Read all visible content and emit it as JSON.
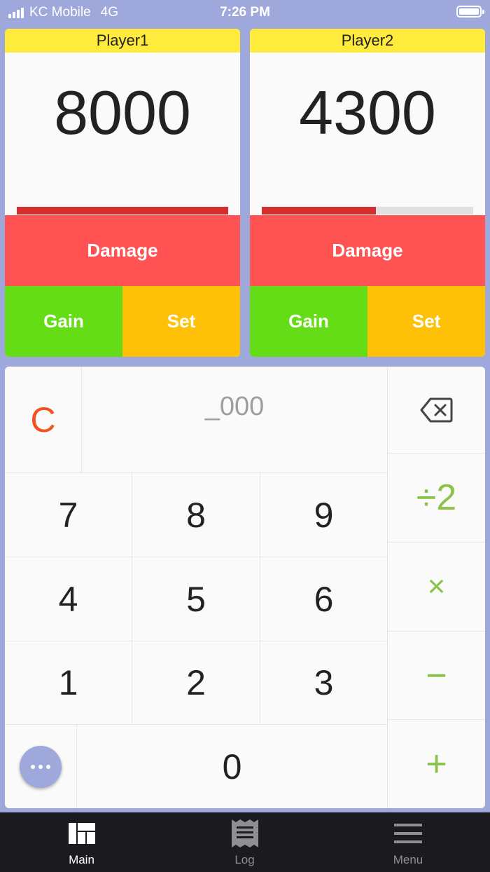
{
  "status_bar": {
    "carrier": "KC Mobile",
    "network": "4G",
    "time": "7:26 PM"
  },
  "players": [
    {
      "name": "Player1",
      "life": "8000",
      "life_fraction": 1.0,
      "damage_label": "Damage",
      "gain_label": "Gain",
      "set_label": "Set"
    },
    {
      "name": "Player2",
      "life": "4300",
      "life_fraction": 0.54,
      "damage_label": "Damage",
      "gain_label": "Gain",
      "set_label": "Set"
    }
  ],
  "keypad": {
    "clear_label": "C",
    "entry_value": "_000",
    "digits": [
      "7",
      "8",
      "9",
      "4",
      "5",
      "6",
      "1",
      "2",
      "3",
      "0"
    ],
    "operators": {
      "half": "÷2",
      "multiply": "×",
      "subtract": "−",
      "add": "+"
    }
  },
  "tabs": [
    {
      "label": "Main",
      "icon": "dashboard-icon",
      "active": true
    },
    {
      "label": "Log",
      "icon": "receipt-icon",
      "active": false
    },
    {
      "label": "Menu",
      "icon": "hamburger-menu-icon",
      "active": false
    }
  ],
  "colors": {
    "background": "#9FA8DA",
    "name_bar": "#FFEB3B",
    "damage": "#FF5252",
    "gain": "#64DD17",
    "set": "#FFC107",
    "life_bar": "#D32F2F",
    "operator": "#8BC34A",
    "clear": "#F4511E",
    "tab_bar": "#1B1B1F"
  }
}
